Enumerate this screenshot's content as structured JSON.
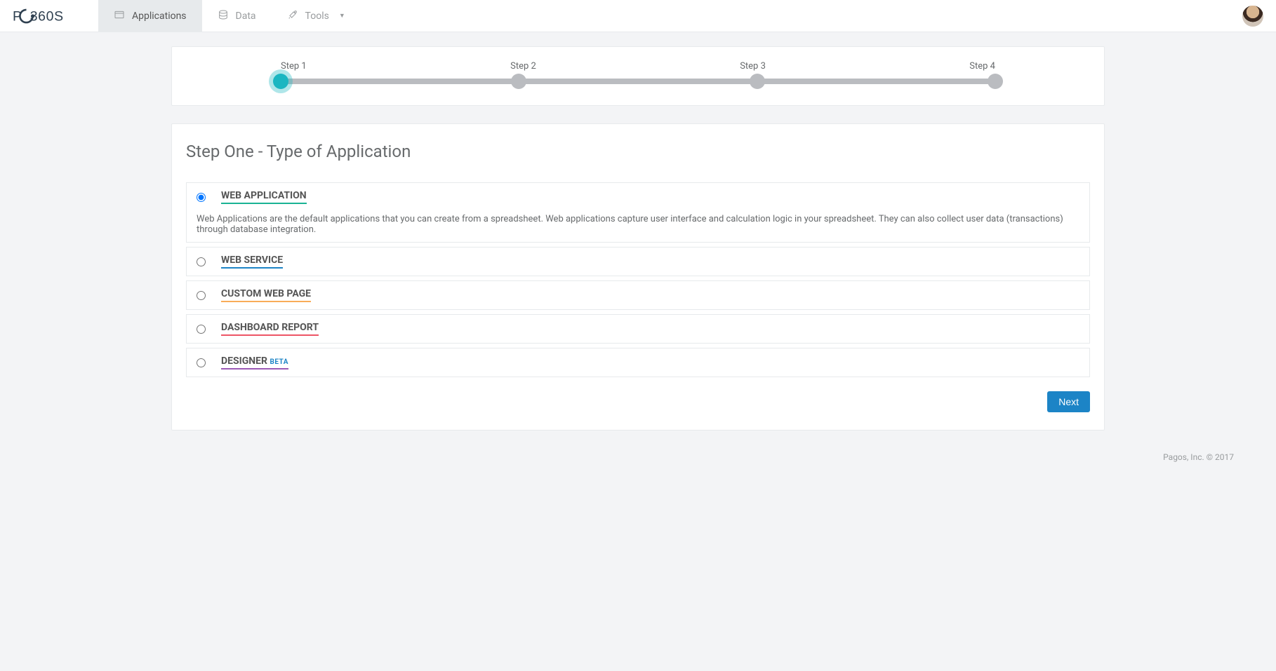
{
  "nav": {
    "applications": "Applications",
    "data": "Data",
    "tools": "Tools"
  },
  "stepper": {
    "step1": "Step 1",
    "step2": "Step 2",
    "step3": "Step 3",
    "step4": "Step 4"
  },
  "page": {
    "title": "Step One - Type of Application"
  },
  "options": {
    "web_app": {
      "label": "WEB APPLICATION",
      "desc": "Web Applications are the default applications that you can create from a spreadsheet. Web applications capture user interface and calculation logic in your spreadsheet. They can also collect user data (transactions) through database integration."
    },
    "web_service": {
      "label": "WEB SERVICE"
    },
    "custom_page": {
      "label": "CUSTOM WEB PAGE"
    },
    "dashboard": {
      "label": "DASHBOARD REPORT"
    },
    "designer": {
      "label": "DESIGNER",
      "beta": "BETA"
    }
  },
  "buttons": {
    "next": "Next"
  },
  "footer": "Pagos, Inc. © 2017"
}
